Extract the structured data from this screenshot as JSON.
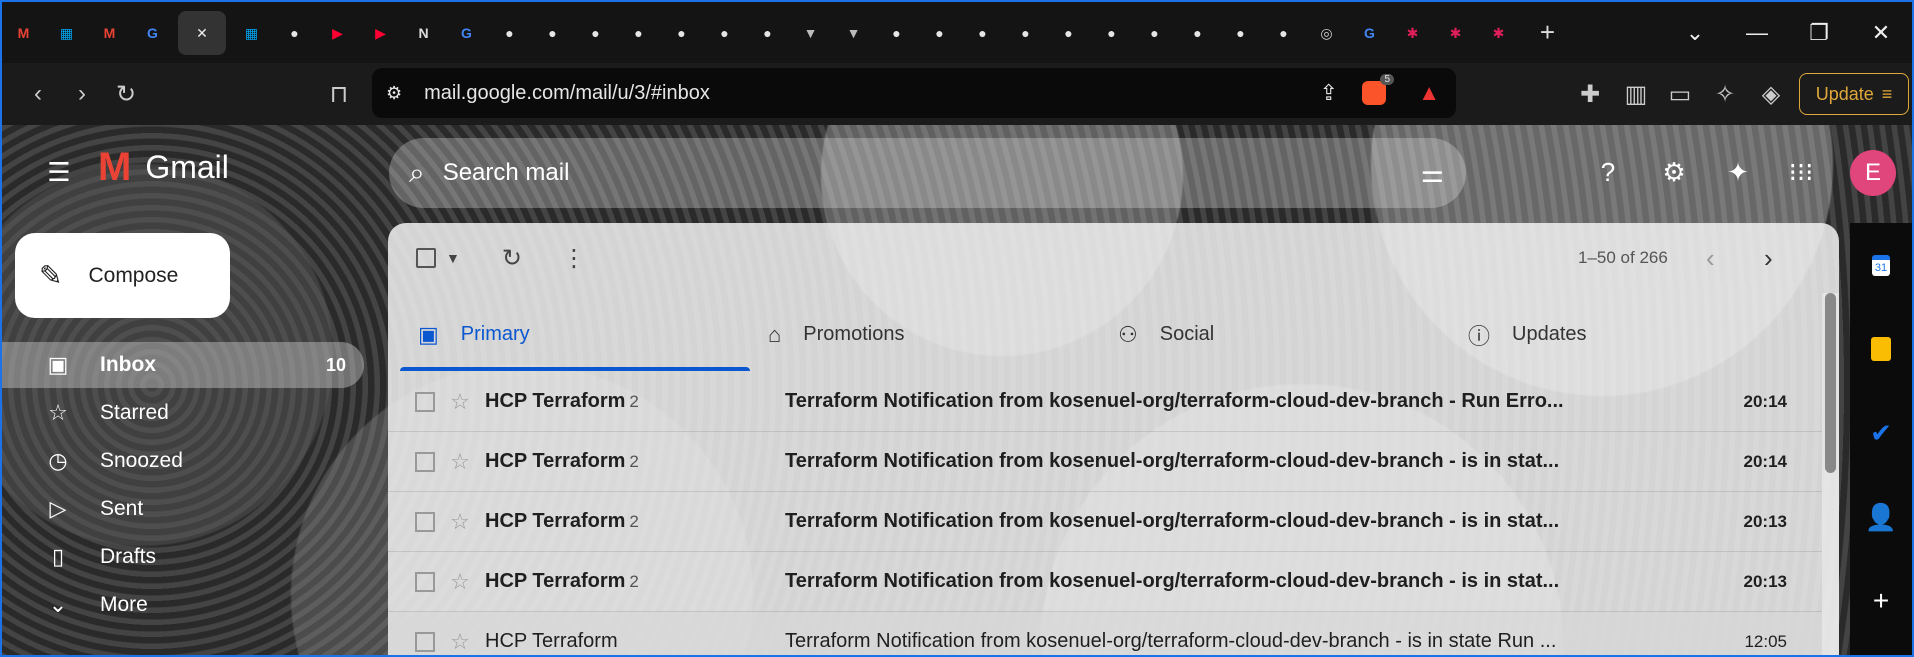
{
  "browser": {
    "tabs": [
      {
        "icon": "gmail-icon",
        "glyph": "M"
      },
      {
        "icon": "microsoft-icon",
        "glyph": "▦"
      },
      {
        "icon": "gmail-icon",
        "glyph": "M"
      },
      {
        "icon": "google-icon",
        "glyph": "G"
      },
      {
        "icon": "close-icon",
        "glyph": "✕",
        "active": true
      },
      {
        "icon": "microsoft-icon",
        "glyph": "▦"
      },
      {
        "icon": "github-icon",
        "glyph": "●"
      },
      {
        "icon": "youtube-icon",
        "glyph": "▶"
      },
      {
        "icon": "youtube-icon",
        "glyph": "▶"
      },
      {
        "icon": "notion-icon",
        "glyph": "N"
      },
      {
        "icon": "google-icon",
        "glyph": "G"
      },
      {
        "icon": "github-icon",
        "glyph": "●"
      },
      {
        "icon": "github-icon",
        "glyph": "●"
      },
      {
        "icon": "github-icon",
        "glyph": "●"
      },
      {
        "icon": "github-icon",
        "glyph": "●"
      },
      {
        "icon": "github-icon",
        "glyph": "●"
      },
      {
        "icon": "github-icon",
        "glyph": "●"
      },
      {
        "icon": "github-icon",
        "glyph": "●"
      },
      {
        "icon": "vercel-icon",
        "glyph": "▼"
      },
      {
        "icon": "vercel-icon",
        "glyph": "▼"
      },
      {
        "icon": "github-icon",
        "glyph": "●"
      },
      {
        "icon": "github-icon",
        "glyph": "●"
      },
      {
        "icon": "github-icon",
        "glyph": "●"
      },
      {
        "icon": "github-icon",
        "glyph": "●"
      },
      {
        "icon": "github-icon",
        "glyph": "●"
      },
      {
        "icon": "github-icon",
        "glyph": "●"
      },
      {
        "icon": "github-icon",
        "glyph": "●"
      },
      {
        "icon": "github-icon",
        "glyph": "●"
      },
      {
        "icon": "github-icon",
        "glyph": "●"
      },
      {
        "icon": "github-icon",
        "glyph": "●"
      },
      {
        "icon": "globe-icon",
        "glyph": "◎"
      },
      {
        "icon": "google-icon",
        "glyph": "G"
      },
      {
        "icon": "slack-icon",
        "glyph": "✱"
      },
      {
        "icon": "slack-icon",
        "glyph": "✱"
      },
      {
        "icon": "slack-icon",
        "glyph": "✱"
      }
    ],
    "url": "mail.google.com/mail/u/3/#inbox",
    "shield_badge": "5",
    "update_label": "Update"
  },
  "gmail": {
    "logo_text": "Gmail",
    "search_placeholder": "Search mail",
    "compose_label": "Compose",
    "nav": [
      {
        "label": "Inbox",
        "icon": "inbox-icon",
        "glyph": "▣",
        "count": "10",
        "active": true
      },
      {
        "label": "Starred",
        "icon": "star-icon",
        "glyph": "☆"
      },
      {
        "label": "Snoozed",
        "icon": "clock-icon",
        "glyph": "◷"
      },
      {
        "label": "Sent",
        "icon": "send-icon",
        "glyph": "▷"
      },
      {
        "label": "Drafts",
        "icon": "draft-icon",
        "glyph": "▯"
      },
      {
        "label": "More",
        "icon": "chevron-down-icon",
        "glyph": "⌄"
      }
    ],
    "pagination": "1–50 of 266",
    "tabs": [
      {
        "label": "Primary",
        "icon": "inbox-icon",
        "glyph": "▣",
        "active": true
      },
      {
        "label": "Promotions",
        "icon": "tag-icon",
        "glyph": "⌂"
      },
      {
        "label": "Social",
        "icon": "people-icon",
        "glyph": "⚇"
      },
      {
        "label": "Updates",
        "icon": "info-icon",
        "glyph": "ⓘ"
      }
    ],
    "emails": [
      {
        "sender": "HCP Terraform",
        "count": "2",
        "subject": "Terraform Notification from kosenuel-org/terraform-cloud-dev-branch - Run Erro...",
        "time": "20:14",
        "unread": true
      },
      {
        "sender": "HCP Terraform",
        "count": "2",
        "subject": "Terraform Notification from kosenuel-org/terraform-cloud-dev-branch - is in stat...",
        "time": "20:14",
        "unread": true
      },
      {
        "sender": "HCP Terraform",
        "count": "2",
        "subject": "Terraform Notification from kosenuel-org/terraform-cloud-dev-branch - is in stat...",
        "time": "20:13",
        "unread": true
      },
      {
        "sender": "HCP Terraform",
        "count": "2",
        "subject": "Terraform Notification from kosenuel-org/terraform-cloud-dev-branch - is in stat...",
        "time": "20:13",
        "unread": true
      },
      {
        "sender": "HCP Terraform",
        "count": "",
        "subject": "Terraform Notification from kosenuel-org/terraform-cloud-dev-branch - is in state Run ...",
        "time": "12:05",
        "unread": false
      }
    ],
    "avatar_letter": "E",
    "calendar_day": "31"
  }
}
